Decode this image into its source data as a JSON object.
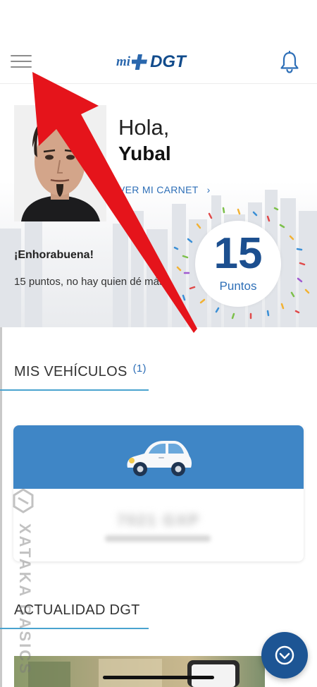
{
  "header": {
    "logo_prefix": "mi",
    "logo_name": "DGT"
  },
  "profile": {
    "greeting": "Hola,",
    "name": "Yubal",
    "carnet_link": "VER MI CARNET",
    "congrats": "¡Enhorabuena!",
    "points_message": "15 puntos, no hay quien dé más.",
    "points_value": "15",
    "points_label": "Puntos"
  },
  "vehicles": {
    "title": "MIS VEHÍCULOS",
    "count": "(1)",
    "plate": "7021 GXP"
  },
  "news": {
    "title": "ACTUALIDAD DGT"
  },
  "watermark": "XATAKA BASICS",
  "colors": {
    "brand_blue": "#1c4f8f",
    "link_blue": "#2e6fb7",
    "vehicle_card_blue": "#3f86c6",
    "annotation_red": "#e5141b"
  }
}
